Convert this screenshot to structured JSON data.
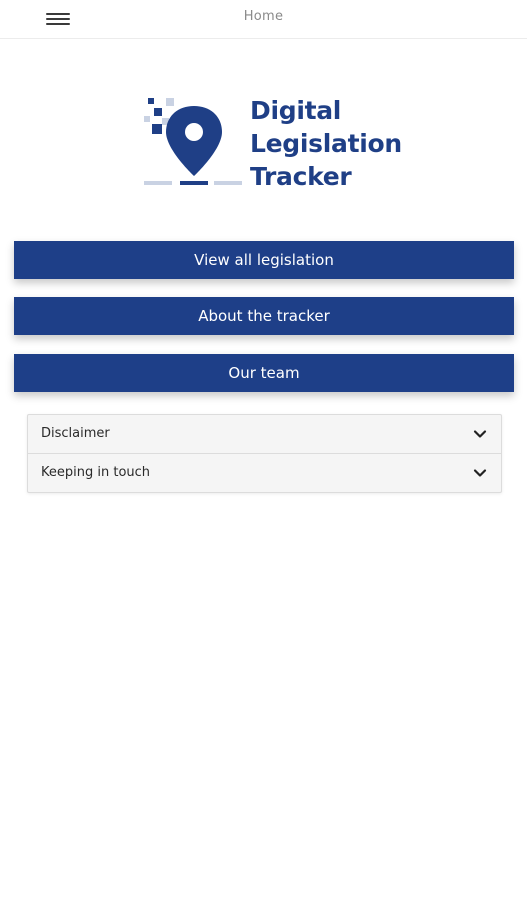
{
  "header": {
    "title": "Home",
    "menu_icon": "hamburger-menu-icon"
  },
  "logo": {
    "line1": "Digital",
    "line2": "Legislation",
    "line3": "Tracker",
    "mark_icon": "location-pin-pixel-icon"
  },
  "buttons": {
    "view_all": "View all legislation",
    "about": "About the tracker",
    "team": "Our team"
  },
  "accordion": {
    "items": [
      {
        "label": "Disclaimer",
        "icon": "chevron-down-icon"
      },
      {
        "label": "Keeping in touch",
        "icon": "chevron-down-icon"
      }
    ]
  },
  "colors": {
    "brand_blue": "#1e3f88",
    "logo_blue": "#1f3f86",
    "logo_light": "#c9d2e3"
  }
}
